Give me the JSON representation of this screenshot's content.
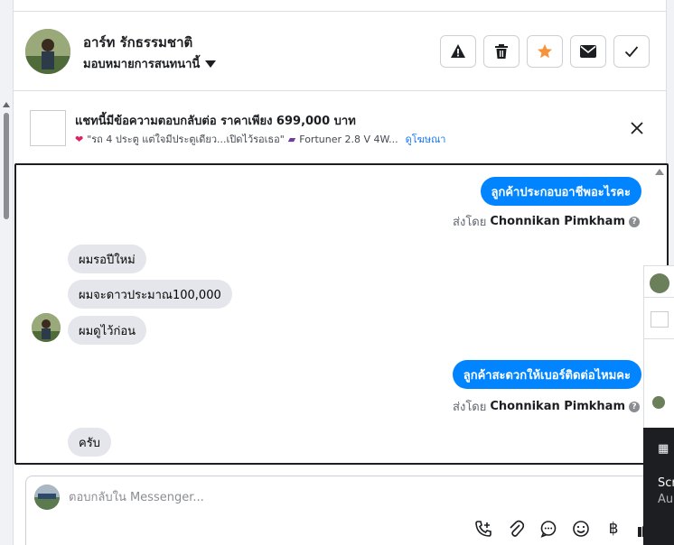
{
  "contact": {
    "name": "อาร์ท รักธรรมชาติ",
    "assign_label": "มอบหมายการสนทนานี้"
  },
  "header_actions": [
    {
      "name": "spam-icon"
    },
    {
      "name": "trash-icon"
    },
    {
      "name": "star-icon"
    },
    {
      "name": "mail-icon"
    },
    {
      "name": "check-icon"
    }
  ],
  "ad": {
    "title": "แชทนี้มีข้อความตอบกลับต่อ ราคาเพียง 699,000 บาท",
    "caption": "\"รถ 4 ประตู แต่ใจมีประตูเดียว...เปิดไว้รอเธอ\"",
    "model": "Fortuner 2.8 V 4W...",
    "link": "ดูโฆษณา"
  },
  "messages": {
    "out1": "ลูกค้าประกอบอาชีพอะไรคะ",
    "sent_by_prefix": "ส่งโดย",
    "sender": "Chonnikan Pimkham",
    "in1": "ผมรอปีใหม่",
    "in2": "ผมจะดาวประมาณ100,000",
    "in3": "ผมดูไว้ก่อน",
    "out2": "ลูกค้าสะดวกให้เบอร์ติดต่อไหมคะ",
    "in4": "ครับ"
  },
  "composer": {
    "placeholder": "ตอบกลับใน Messenger..."
  },
  "side_panel": {
    "line1": "Scr",
    "line2": "Au"
  },
  "colors": {
    "accent": "#0084ff",
    "star": "#f7923b"
  }
}
